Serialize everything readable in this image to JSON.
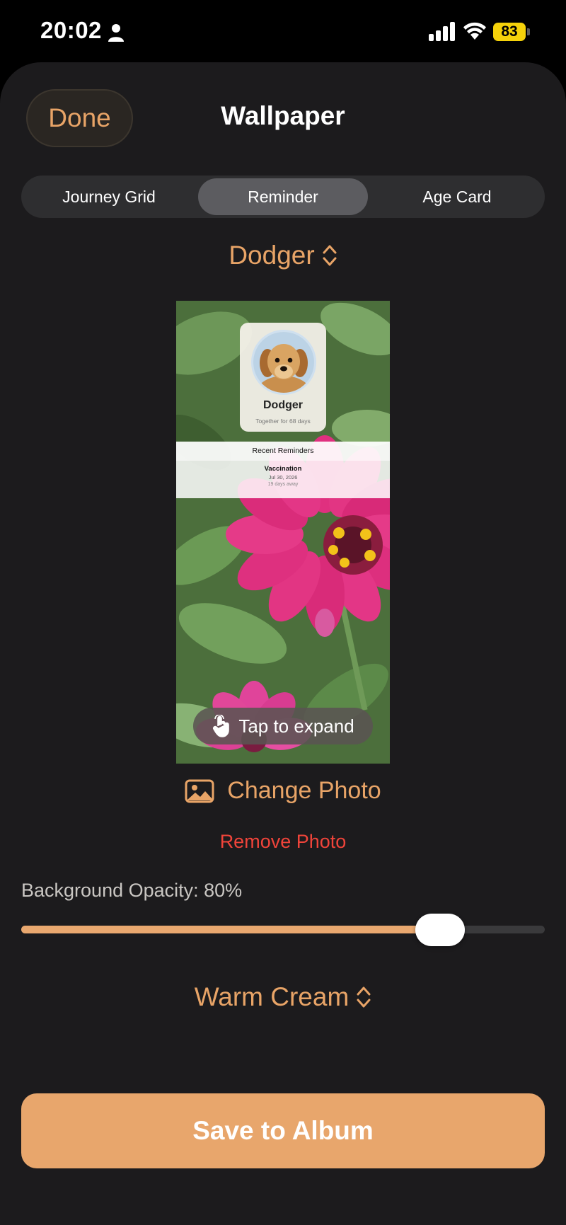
{
  "status_bar": {
    "time": "20:02",
    "battery": "83",
    "battery_color": "#f5d20a"
  },
  "header": {
    "done_label": "Done",
    "title": "Wallpaper"
  },
  "segments": [
    {
      "label": "Journey Grid",
      "selected": false
    },
    {
      "label": "Reminder",
      "selected": true
    },
    {
      "label": "Age Card",
      "selected": false
    }
  ],
  "pet_picker": {
    "label": "Dodger",
    "icon": "chevron-up-down-icon"
  },
  "preview": {
    "pet_name": "Dodger",
    "together_text": "Together for 68 days",
    "reminders_heading": "Recent Reminders",
    "reminder": {
      "title": "Vaccination",
      "date": "Jul 30, 2026",
      "away": "19 days away"
    },
    "expand_label": "Tap to expand"
  },
  "photo": {
    "change_label": "Change Photo",
    "remove_label": "Remove Photo"
  },
  "opacity": {
    "label": "Background Opacity: 80%",
    "value": 0.8
  },
  "theme_picker": {
    "label": "Warm Cream",
    "icon": "chevron-up-down-icon"
  },
  "save_label": "Save to Album",
  "colors": {
    "accent": "#e8a467",
    "destructive": "#f0443a",
    "sheet_background": "#1c1b1d"
  }
}
